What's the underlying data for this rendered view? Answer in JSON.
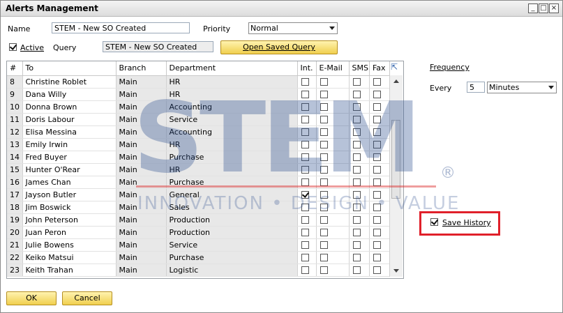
{
  "window": {
    "title": "Alerts Management"
  },
  "form": {
    "name_label": "Name",
    "name_value": "STEM - New SO Created",
    "priority_label": "Priority",
    "priority_value": "Normal",
    "active_label": "Active",
    "active_checked": true,
    "query_label": "Query",
    "query_value": "STEM - New SO Created",
    "open_query_button": "Open Saved Query"
  },
  "grid": {
    "columns": [
      "#",
      "To",
      "Branch",
      "Department",
      "Int.",
      "E-Mail",
      "SMS",
      "Fax"
    ],
    "rows": [
      {
        "num": "8",
        "to": "Christine Roblet",
        "branch": "Main",
        "dept": "HR",
        "int": false
      },
      {
        "num": "9",
        "to": "Dana Willy",
        "branch": "Main",
        "dept": "HR",
        "int": false
      },
      {
        "num": "10",
        "to": "Donna Brown",
        "branch": "Main",
        "dept": "Accounting",
        "int": false
      },
      {
        "num": "11",
        "to": "Doris Labour",
        "branch": "Main",
        "dept": "Service",
        "int": false
      },
      {
        "num": "12",
        "to": "Elisa Messina",
        "branch": "Main",
        "dept": "Accounting",
        "int": false
      },
      {
        "num": "13",
        "to": "Emily Irwin",
        "branch": "Main",
        "dept": "HR",
        "int": false
      },
      {
        "num": "14",
        "to": "Fred Buyer",
        "branch": "Main",
        "dept": "Purchase",
        "int": false
      },
      {
        "num": "15",
        "to": "Hunter O'Rear",
        "branch": "Main",
        "dept": "HR",
        "int": false
      },
      {
        "num": "16",
        "to": "James Chan",
        "branch": "Main",
        "dept": "Purchase",
        "int": false
      },
      {
        "num": "17",
        "to": "Jayson Butler",
        "branch": "Main",
        "dept": "General",
        "int": true
      },
      {
        "num": "18",
        "to": "Jim Boswick",
        "branch": "Main",
        "dept": "Sales",
        "int": false
      },
      {
        "num": "19",
        "to": "John Peterson",
        "branch": "Main",
        "dept": "Production",
        "int": false
      },
      {
        "num": "20",
        "to": "Juan Peron",
        "branch": "Main",
        "dept": "Production",
        "int": false
      },
      {
        "num": "21",
        "to": "Julie Bowens",
        "branch": "Main",
        "dept": "Service",
        "int": false
      },
      {
        "num": "22",
        "to": "Keiko Matsui",
        "branch": "Main",
        "dept": "Purchase",
        "int": false
      },
      {
        "num": "23",
        "to": "Keith Trahan",
        "branch": "Main",
        "dept": "Logistic",
        "int": false
      }
    ]
  },
  "frequency": {
    "label": "Frequency",
    "every_label": "Every",
    "every_value": "5",
    "unit_value": "Minutes"
  },
  "save_history": {
    "label": "Save History",
    "checked": true
  },
  "buttons": {
    "ok": "OK",
    "cancel": "Cancel"
  },
  "watermark": {
    "text": "STEM",
    "tagline": "INNOVATION • DESIGN • VALUE",
    "reg": "®"
  },
  "colors": {
    "accent_yellow": "#f0cf4e",
    "highlight_red": "#e0202a",
    "watermark_blue": "#2f4f8f"
  },
  "icons": {
    "window": [
      "minimize-icon",
      "maximize-icon",
      "close-icon"
    ],
    "grid": [
      "expand-icon",
      "scroll-up-icon",
      "scroll-down-icon"
    ]
  }
}
